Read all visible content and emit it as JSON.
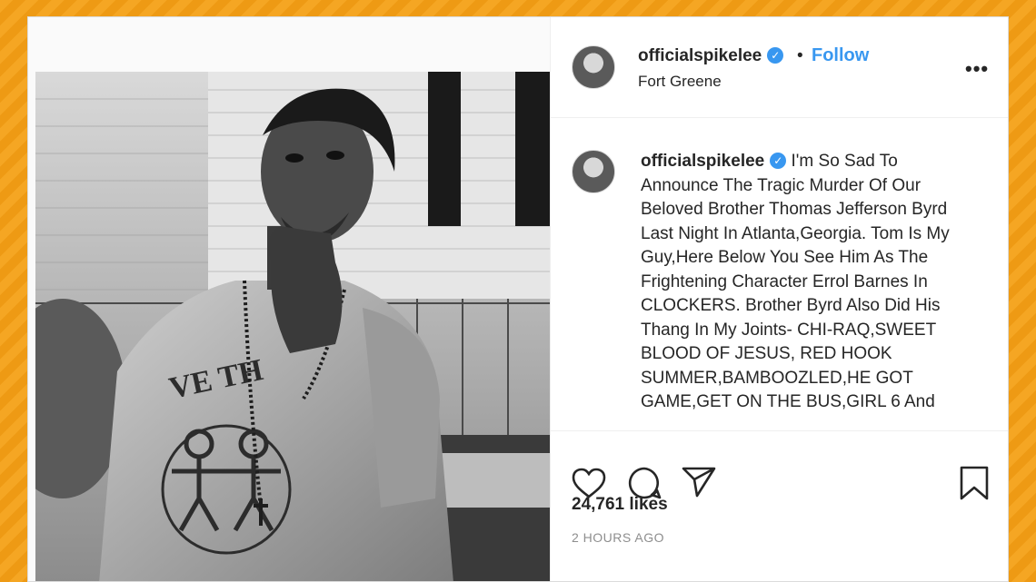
{
  "header": {
    "username": "officialspikelee",
    "separator": "•",
    "follow_label": "Follow",
    "location": "Fort Greene",
    "more_label": "•••"
  },
  "caption": {
    "username": "officialspikelee",
    "text": "I'm So Sad To Announce The Tragic Murder Of Our Beloved Brother Thomas Jefferson Byrd Last Night In Atlanta,Georgia. Tom Is My Guy,Here Below You See Him As The Frightening Character Errol Barnes In CLOCKERS. Brother Byrd Also Did His Thang In My Joints- CHI-RAQ,SWEET BLOOD OF JESUS, RED HOOK SUMMER,BAMBOOZLED,HE GOT GAME,GET ON THE BUS,GIRL 6 And"
  },
  "actions": {
    "like_icon": "heart-icon",
    "comment_icon": "comment-icon",
    "share_icon": "paper-plane-icon",
    "save_icon": "bookmark-icon"
  },
  "stats": {
    "likes": "24,761 likes",
    "time_ago": "2 HOURS AGO"
  },
  "photo": {
    "shirt_text": "VE TH"
  },
  "colors": {
    "accent": "#3897f0",
    "frame": "#f5a623",
    "text": "#262626",
    "muted": "#8e8e8e"
  }
}
